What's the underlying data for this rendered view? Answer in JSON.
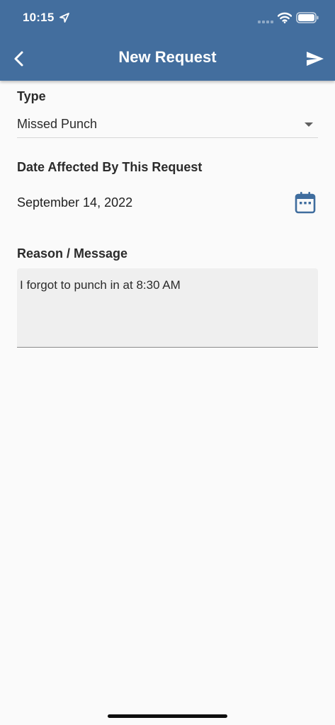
{
  "status_bar": {
    "time": "10:15",
    "icons": [
      "location-arrow-icon",
      "cellular-signal-icon",
      "wifi-icon",
      "battery-icon"
    ]
  },
  "nav": {
    "title": "New Request",
    "back_icon": "chevron-left-icon",
    "send_icon": "send-icon"
  },
  "form": {
    "type_label": "Type",
    "type_value": "Missed Punch",
    "date_label": "Date Affected By This Request",
    "date_value": "September 14, 2022",
    "date_icon": "calendar-icon",
    "reason_label": "Reason / Message",
    "reason_value": "I forgot to punch in at 8:30 AM"
  },
  "colors": {
    "header": "#436e9e",
    "accent": "#3f6d9e",
    "background": "#fafafa",
    "input_fill": "#efefef"
  }
}
